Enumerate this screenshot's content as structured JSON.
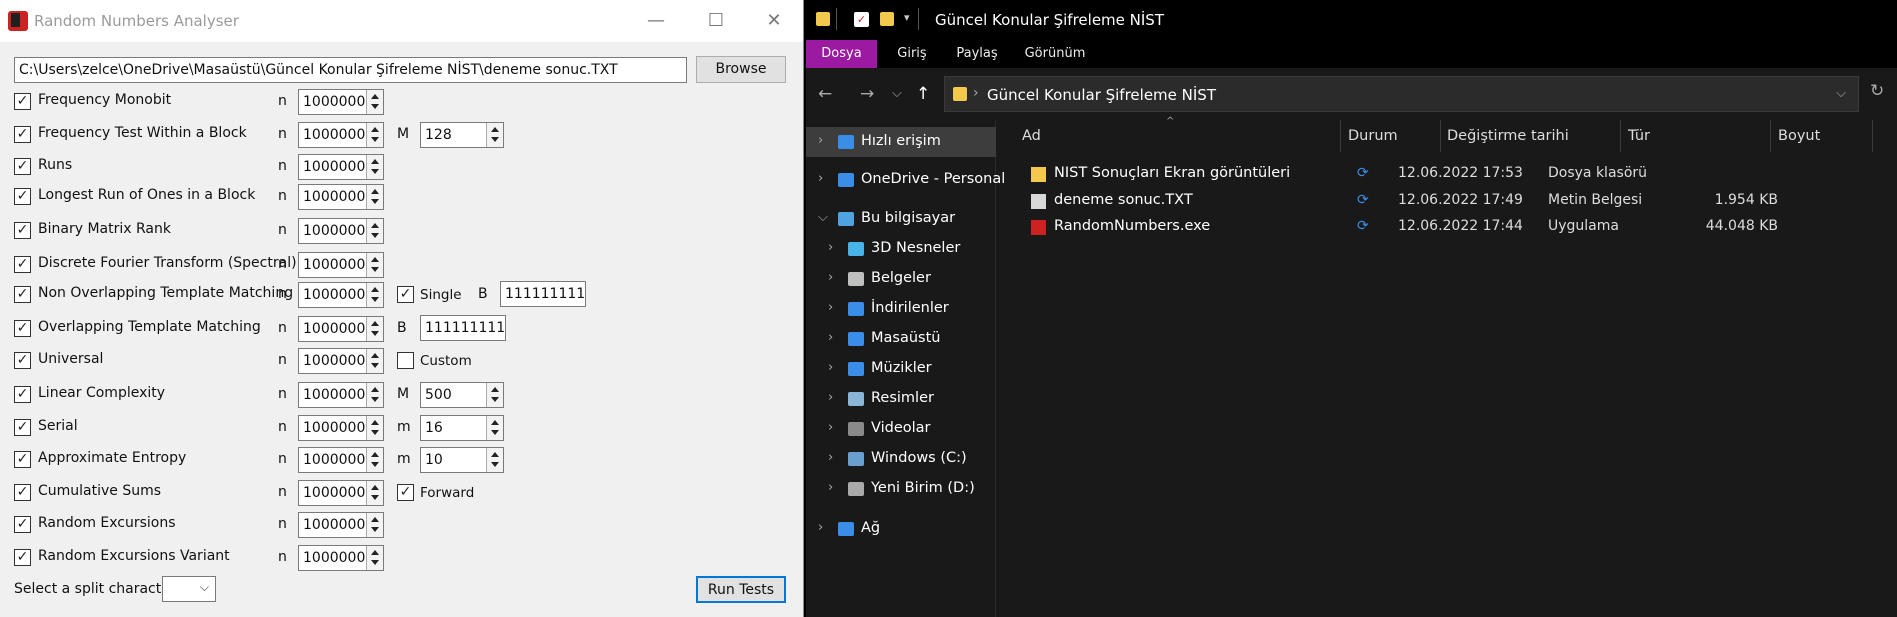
{
  "dialog": {
    "title": "Random Numbers Analyser",
    "file_path": "C:\\Users\\zelce\\OneDrive\\Masaüstü\\Güncel Konular Şifreleme NİST\\deneme sonuc.TXT",
    "browse_label": "Browse",
    "n_label": "n",
    "tests": [
      {
        "label": "Frequency Monobit",
        "checked": true,
        "n": "1000000"
      },
      {
        "label": "Frequency Test Within a Block",
        "checked": true,
        "n": "1000000",
        "param_label": "M",
        "param_value": "128"
      },
      {
        "label": "Runs",
        "checked": true,
        "n": "1000000"
      },
      {
        "label": "Longest Run of Ones in a Block",
        "checked": true,
        "n": "1000000"
      },
      {
        "label": "Binary Matrix Rank",
        "checked": true,
        "n": "1000000"
      },
      {
        "label": "Discrete Fourier Transform (Spectral)",
        "checked": true,
        "n": "1000000"
      },
      {
        "label": "Non Overlapping Template Matching",
        "checked": true,
        "n": "1000000",
        "option_label": "Single",
        "option_checked": true,
        "param_label": "B",
        "param_value": "111111111"
      },
      {
        "label": "Overlapping Template Matching",
        "checked": true,
        "n": "1000000",
        "param_label": "B",
        "param_value": "111111111"
      },
      {
        "label": "Universal",
        "checked": true,
        "n": "1000000",
        "option_label": "Custom",
        "option_checked": false
      },
      {
        "label": "Linear Complexity",
        "checked": true,
        "n": "1000000",
        "param_label": "M",
        "param_value": "500"
      },
      {
        "label": "Serial",
        "checked": true,
        "n": "1000000",
        "param_label": "m",
        "param_value": "16"
      },
      {
        "label": "Approximate Entropy",
        "checked": true,
        "n": "1000000",
        "param_label": "m",
        "param_value": "10"
      },
      {
        "label": "Cumulative Sums",
        "checked": true,
        "n": "1000000",
        "option_label": "Forward",
        "option_checked": true
      },
      {
        "label": "Random Excursions",
        "checked": true,
        "n": "1000000"
      },
      {
        "label": "Random Excursions Variant",
        "checked": true,
        "n": "1000000"
      }
    ],
    "split_label": "Select a split character",
    "split_value": "",
    "run_label": "Run Tests"
  },
  "explorer": {
    "window_title": "Güncel Konular Şifreleme NİST",
    "ribbon_tabs": [
      "Dosya",
      "Giriş",
      "Paylaş",
      "Görünüm"
    ],
    "breadcrumb": "Güncel Konular Şifreleme NİST",
    "nav_tree": [
      {
        "label": "Hızlı erişim",
        "icon": "star-icon",
        "color": "#3b8ee8",
        "selected": true
      },
      {
        "label": "OneDrive - Personal",
        "icon": "cloud-icon",
        "color": "#3b8ee8"
      },
      {
        "label": "Bu bilgisayar",
        "icon": "computer-icon",
        "color": "#4fa3e0",
        "expanded": true
      },
      {
        "label": "3D Nesneler",
        "icon": "cube-icon",
        "color": "#49b3e8"
      },
      {
        "label": "Belgeler",
        "icon": "document-icon",
        "color": "#bfbfbf"
      },
      {
        "label": "İndirilenler",
        "icon": "download-icon",
        "color": "#3b8ee8"
      },
      {
        "label": "Masaüstü",
        "icon": "desktop-icon",
        "color": "#3b8ee8"
      },
      {
        "label": "Müzikler",
        "icon": "music-icon",
        "color": "#3b8ee8"
      },
      {
        "label": "Resimler",
        "icon": "pictures-icon",
        "color": "#8ab4d8"
      },
      {
        "label": "Videolar",
        "icon": "video-icon",
        "color": "#8a8a8a"
      },
      {
        "label": "Windows (C:)",
        "icon": "drive-icon",
        "color": "#6aa0d0"
      },
      {
        "label": "Yeni Birim (D:)",
        "icon": "drive-icon",
        "color": "#aaaaaa"
      },
      {
        "label": "Ağ",
        "icon": "network-icon",
        "color": "#3b8ee8"
      }
    ],
    "columns": {
      "name": "Ad",
      "status": "Durum",
      "modified": "Değiştirme tarihi",
      "type": "Tür",
      "size": "Boyut"
    },
    "files": [
      {
        "name": "NIST Sonuçları Ekran görüntüleri",
        "icon": "folder-icon",
        "status": "⟳",
        "modified": "12.06.2022 17:53",
        "type": "Dosya klasörü",
        "size": ""
      },
      {
        "name": "deneme sonuc.TXT",
        "icon": "text-file-icon",
        "status": "⟳",
        "modified": "12.06.2022 17:49",
        "type": "Metin Belgesi",
        "size": "1.954 KB"
      },
      {
        "name": "RandomNumbers.exe",
        "icon": "exe-icon",
        "status": "⟳",
        "modified": "12.06.2022 17:44",
        "type": "Uygulama",
        "size": "44.048 KB"
      }
    ],
    "colors": {
      "ribbon_active": "#9b1aa1",
      "sync_status": "#3b8ee8",
      "folder": "#f2c94c"
    }
  }
}
